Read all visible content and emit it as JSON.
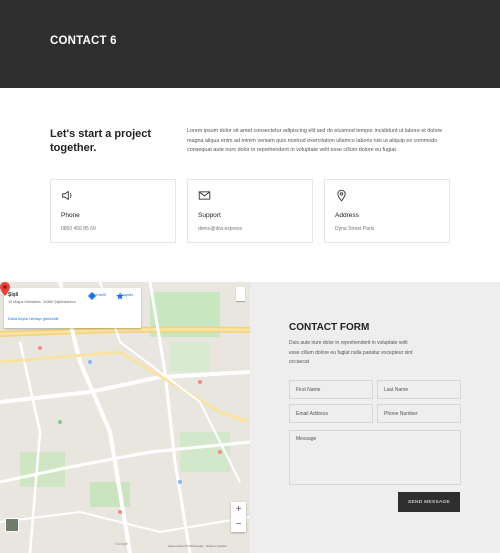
{
  "hero": {
    "title": "CONTACT 6"
  },
  "intro": {
    "heading": "Let's start a project together.",
    "text": "Lorem ipsum dolor sit amet consectetur adipiscing elit sed do eiusmod tempor incididunt ut labore et dolore magna aliqua enim ad minim veniam quis nostrud exercitation ullamco laboris nisi ut aliquip ex commodo consequat aute irure dolor in reprehenderit in voluptate velit esse cillum dolore eu fugiat."
  },
  "cards": [
    {
      "icon": "speaker-icon",
      "title": "Phone",
      "value": "0850 456 85 69"
    },
    {
      "icon": "mail-icon",
      "title": "Support",
      "value": "demo@divi.express"
    },
    {
      "icon": "location-pin-icon",
      "title": "Address",
      "value": "Dyna Street Paris"
    }
  ],
  "map": {
    "place_name": "Şişli",
    "address": "19 Mayıs Mahallesi, 34360 Şişli/İstanbul",
    "larger_map": "Daha büyük haritayı görüntüle",
    "directions": "Yol tarifi",
    "save": "Kaydet",
    "footer": "Harita verileri ©2019 Google · Kullanım Şartları",
    "brand": "Google"
  },
  "form": {
    "title": "CONTACT FORM",
    "description": "Duis aute irure dolor in reprehenderit in voluptate velit esse cillum dolore eu fugiat nulla pariatur excepteur sint occaecat",
    "first_name": "First Name",
    "last_name": "Last Name",
    "email": "Email Address",
    "phone": "Phone Number",
    "message": "Message",
    "submit": "SEND MESSAGE"
  },
  "colors": {
    "hero_bg": "#2f2f2f",
    "form_bg": "#eeeeee",
    "button_bg": "#2e2e2e",
    "map_pin": "#ea4335",
    "link": "#1a73e8"
  }
}
